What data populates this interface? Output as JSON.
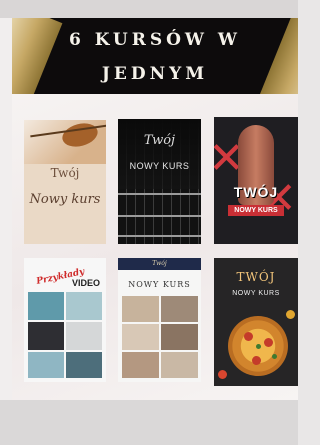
{
  "banner": {
    "title_line1": "6 KURSÓW W",
    "title_line2": "JEDNYM"
  },
  "cards": [
    {
      "line1": "Twój",
      "line2": "Nowy kurs"
    },
    {
      "line1": "Twój",
      "line2": "NOWY KURS"
    },
    {
      "line1": "TWÓJ",
      "line2": "NOWY KURS"
    },
    {
      "line1": "Przykłady",
      "line2": "VIDEO"
    },
    {
      "line0": "Twój",
      "line1": "NOWY KURS"
    },
    {
      "line1": "TWÓJ",
      "line2": "NOWY KURS"
    }
  ],
  "colors": {
    "banner_bg": "#0d0b0c",
    "gold": "#c6a865",
    "accent_red": "#c92f35"
  }
}
